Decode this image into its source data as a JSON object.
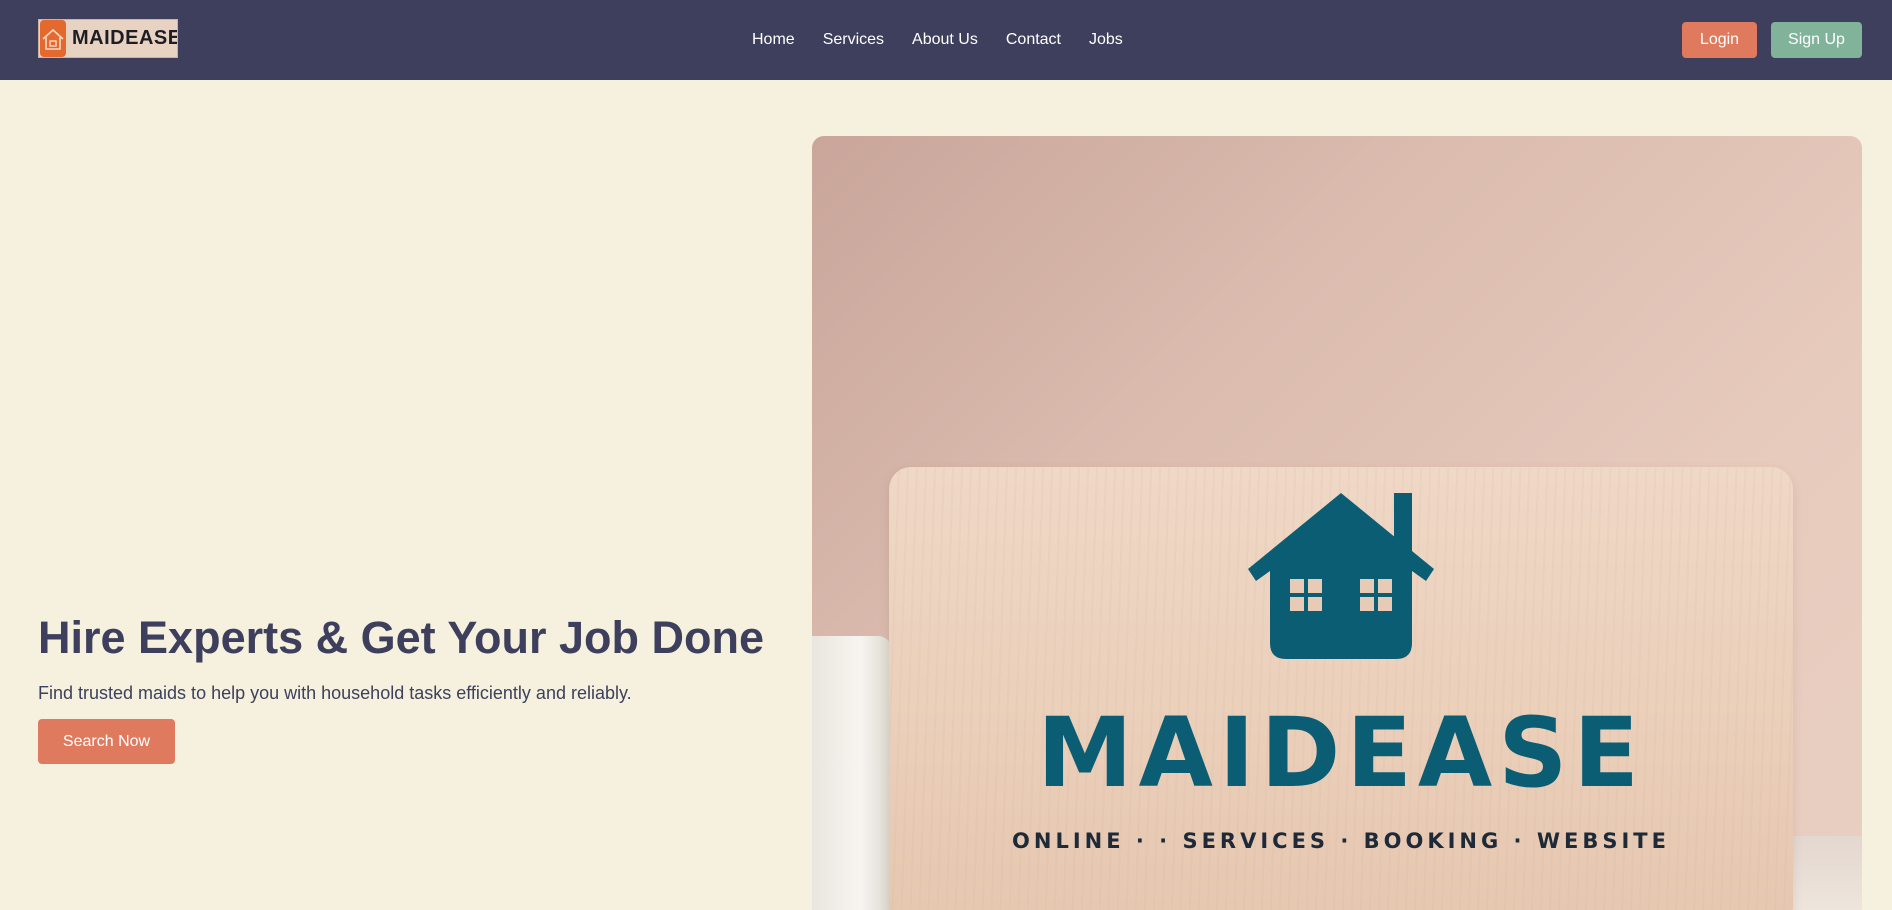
{
  "colors": {
    "nav_bg": "#3d3f5c",
    "page_bg": "#f5f1de",
    "accent": "#e07a5f",
    "secondary": "#81b29a",
    "brand_teal": "#0b5d74",
    "logo_orange": "#e4692f"
  },
  "header": {
    "logo_text": "MAIDEASE",
    "logo_icon": "house-icon",
    "nav": [
      {
        "label": "Home"
      },
      {
        "label": "Services"
      },
      {
        "label": "About Us"
      },
      {
        "label": "Contact"
      },
      {
        "label": "Jobs"
      }
    ],
    "login_label": "Login",
    "signup_label": "Sign Up"
  },
  "hero": {
    "title": "Hire Experts & Get Your Job Done",
    "subtitle": "Find trusted maids to help you with household tasks efficiently and reliably.",
    "cta_label": "Search Now",
    "image": {
      "brand": "MAIDEASE",
      "tagline": "ONLINE · · SERVICES · BOOKING · WEBSITE",
      "icon": "house-icon"
    }
  }
}
